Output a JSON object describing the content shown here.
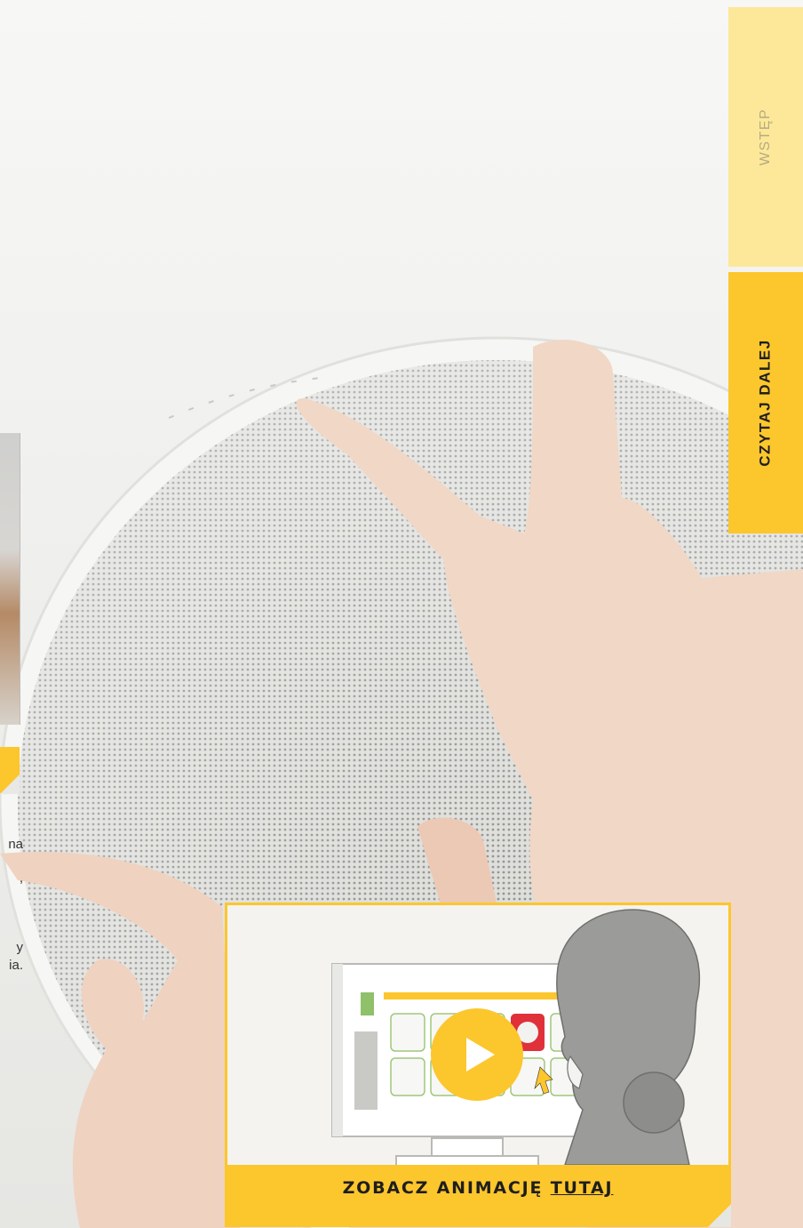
{
  "nav": {
    "intro_label": "WSTĘP",
    "read_more_label": "CZYTAJ DALEJ"
  },
  "left_text_fragments": [
    "na",
    ",",
    "y",
    "ia."
  ],
  "video": {
    "caption_prefix": "ZOBACZ ANIMACJĘ",
    "caption_link": "TUTAJ",
    "play_icon": "play-icon"
  },
  "colors": {
    "accent": "#fcc62d",
    "accent_light": "#fde89a"
  }
}
